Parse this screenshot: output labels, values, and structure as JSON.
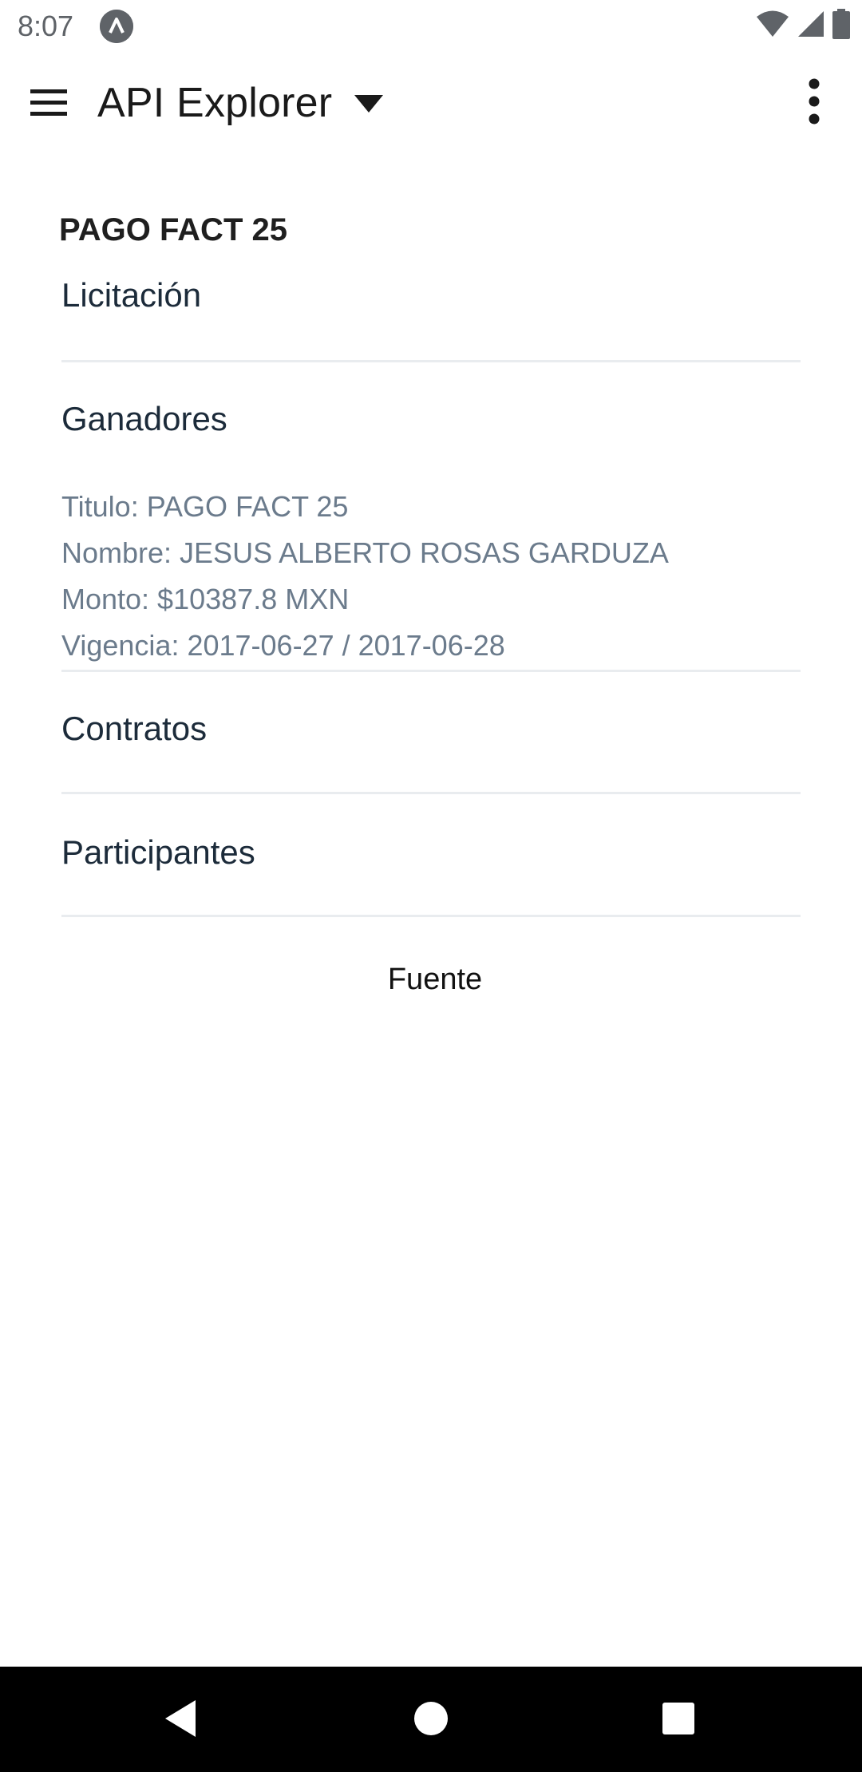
{
  "status_bar": {
    "time": "8:07"
  },
  "app_bar": {
    "title": "API Explorer"
  },
  "record": {
    "title": "PAGO FACT 25"
  },
  "sections": {
    "licitacion": "Licitación",
    "ganadores": "Ganadores",
    "contratos": "Contratos",
    "participantes": "Participantes"
  },
  "ganadores_detail": {
    "titulo": "Titulo: PAGO FACT 25",
    "nombre": "Nombre: JESUS ALBERTO ROSAS GARDUZA",
    "monto": "Monto: $10387.8 MXN",
    "vigencia": "Vigencia: 2017-06-27 / 2017-06-28"
  },
  "footer": {
    "source_label": "Fuente"
  },
  "icons": {
    "menu": "hamburger-menu-icon",
    "dropdown": "triangle-down-icon",
    "overflow": "more-vertical-icon",
    "wifi": "wifi-icon",
    "signal": "cell-signal-icon",
    "battery": "battery-icon",
    "back": "back-triangle-icon",
    "home": "home-circle-icon",
    "recents": "recents-square-icon"
  },
  "colors": {
    "background": "#ffffff",
    "section_text": "#1c2b3a",
    "detail_text": "#6b7b8c",
    "divider": "#e9ecef",
    "nav_bar": "#000000"
  }
}
